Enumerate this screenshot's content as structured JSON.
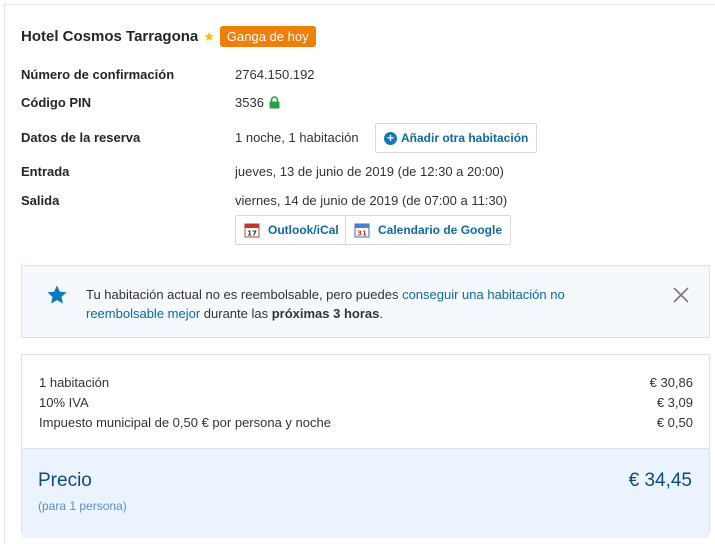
{
  "hotel": {
    "name": "Hotel Cosmos Tarragona",
    "deal_badge": "Ganga de hoy"
  },
  "details": {
    "confirmation_label": "Número de confirmación",
    "confirmation_value": "2764.150.192",
    "pin_label": "Código PIN",
    "pin_value": "3536",
    "booking_label": "Datos de la reserva",
    "booking_value": "1 noche, 1 habitación",
    "add_room_label": "Añadir otra habitación",
    "checkin_label": "Entrada",
    "checkin_value": "jueves, 13 de junio de 2019 (de 12:30 a 20:00)",
    "checkout_label": "Salida",
    "checkout_value": "viernes, 14 de junio de 2019 (de 07:00 a 11:30)",
    "outlook_label": "Outlook/iCal",
    "google_label": "Calendario de Google"
  },
  "notice": {
    "text_before": "Tu habitación actual no es reembolsable, pero puedes ",
    "link": "conseguir una habitación no reembolsable mejor",
    "text_middle": " durante las ",
    "bold": "próximas 3 horas",
    "text_after": "."
  },
  "price": {
    "rows": [
      {
        "label": "1 habitación",
        "value": "€ 30,86"
      },
      {
        "label": "10% IVA",
        "value": "€ 3,09"
      },
      {
        "label": "Impuesto municipal de 0,50 € por persona y noche",
        "value": "€ 0,50"
      }
    ],
    "total_label": "Precio",
    "total_value": "€ 34,45",
    "total_sub": "(para 1 persona)"
  },
  "colors": {
    "badge": "#f07f0a",
    "link": "#0e6aa6",
    "accent": "#0e78c1",
    "total_band": "#ebf3ff"
  },
  "icons": {
    "star": "star-icon",
    "lock": "lock-icon",
    "plus": "plus-circle-icon",
    "outlook": "calendar-icon",
    "google": "google-calendar-icon",
    "notice": "star-icon",
    "close": "close-icon"
  }
}
